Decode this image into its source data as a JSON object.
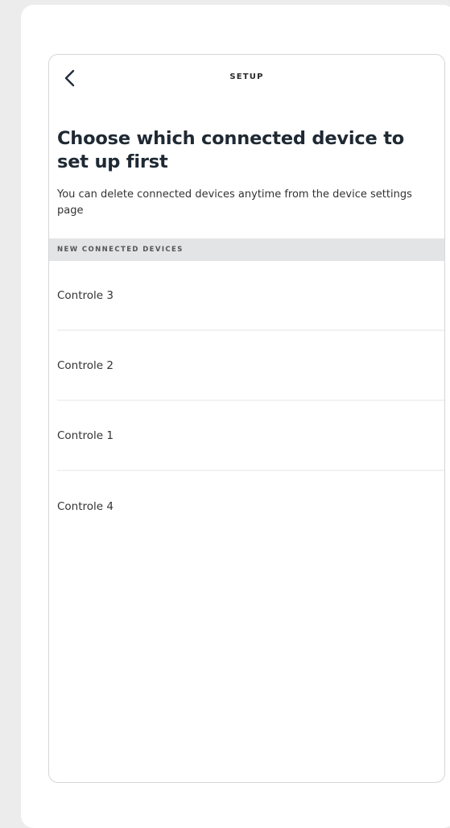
{
  "header": {
    "title": "SETUP",
    "back_icon": "chevron-left-icon"
  },
  "main": {
    "title": "Choose which connected device to set up first",
    "subtitle": "You can delete connected devices anytime from the device settings page"
  },
  "section": {
    "label": "NEW CONNECTED DEVICES"
  },
  "devices": [
    {
      "label": "Controle 3"
    },
    {
      "label": "Controle 2"
    },
    {
      "label": "Controle 1"
    },
    {
      "label": "Controle 4"
    }
  ]
}
